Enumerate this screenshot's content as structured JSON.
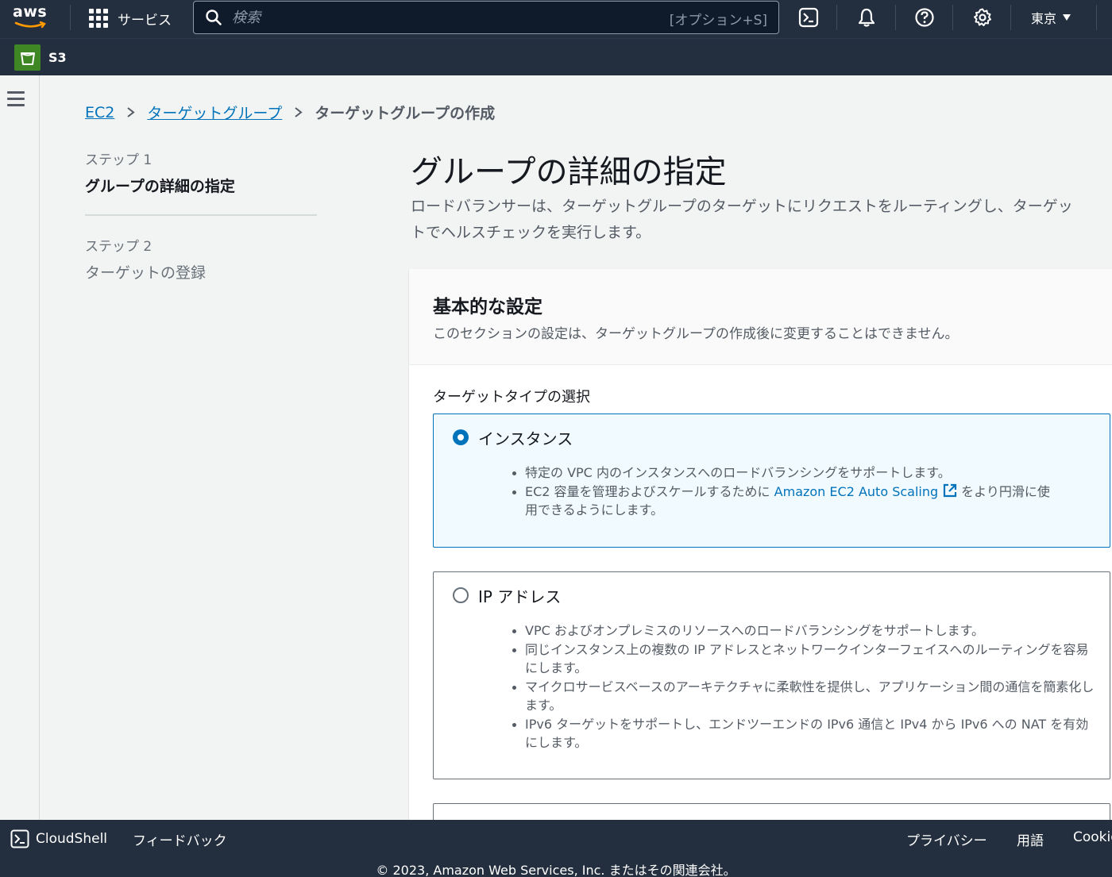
{
  "topnav": {
    "logo_text": "aws",
    "services_label": "サービス",
    "search_placeholder": "検索",
    "search_shortcut": "[オプション+S]",
    "region_label": "東京"
  },
  "service_bar": {
    "service_name": "S3"
  },
  "breadcrumb": {
    "items": [
      "EC2",
      "ターゲットグループ"
    ],
    "current": "ターゲットグループの作成"
  },
  "steps": [
    {
      "number": "ステップ 1",
      "name": "グループの詳細の指定"
    },
    {
      "number": "ステップ 2",
      "name": "ターゲットの登録"
    }
  ],
  "main": {
    "title": "グループの詳細の指定",
    "description_line1": "ロードバランサーは、ターゲットグループのターゲットにリクエストをルーティングし、ターゲッ",
    "description_line2": "トでヘルスチェックを実行します。"
  },
  "basic_settings": {
    "title": "基本的な設定",
    "description": "このセクションの設定は、ターゲットグループの作成後に変更することはできません。",
    "target_type_label": "ターゲットタイプの選択",
    "options": [
      {
        "label": "インスタンス",
        "selected": true,
        "bullets": [
          "特定の VPC 内のインスタンスへのロードバランシングをサポートします。",
          "EC2 容量を管理およびスケールするために"
        ],
        "link_text": "Amazon EC2 Auto Scaling",
        "link_suffix_line1": "をより円滑に使",
        "link_suffix_line2": "用できるようにします。"
      },
      {
        "label": "IP アドレス",
        "selected": false,
        "bullets": [
          "VPC およびオンプレミスのリソースへのロードバランシングをサポートします。",
          "同じインスタンス上の複数の IP アドレスとネットワークインターフェイスへのルーティングを容易にします。",
          "マイクロサービスベースのアーキテクチャに柔軟性を提供し、アプリケーション間の通信を簡素化します。",
          "IPv6 ターゲットをサポートし、エンドツーエンドの IPv6 通信と IPv4 から IPv6 への NAT を有効にします。"
        ]
      }
    ]
  },
  "footer": {
    "cloudshell": "CloudShell",
    "feedback": "フィードバック",
    "privacy": "プライバシー",
    "terms": "用語",
    "cookie": "Cookie",
    "copyright": "© 2023, Amazon Web Services, Inc. またはその関連会社。"
  },
  "colors": {
    "nav_bg": "#232f3e",
    "link": "#0073bb",
    "selected_tile_bg": "#f1faff",
    "s3_green": "#3f8624"
  }
}
